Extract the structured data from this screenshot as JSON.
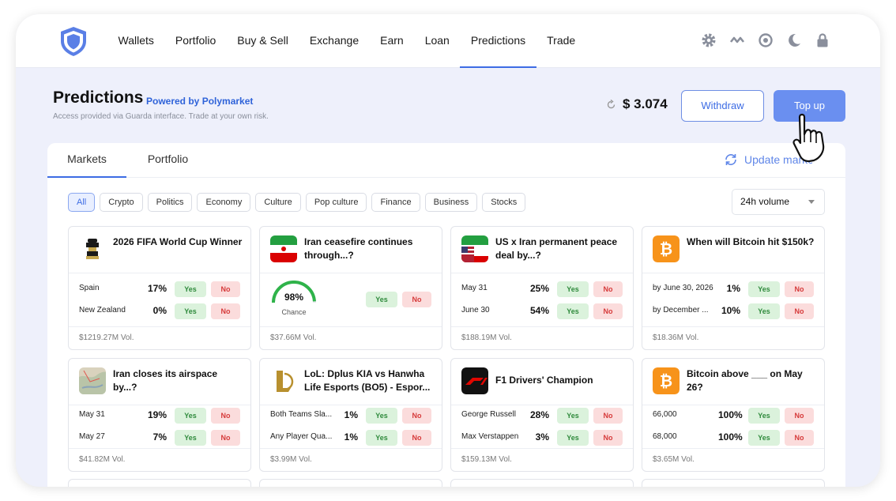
{
  "nav": {
    "items": [
      "Wallets",
      "Portfolio",
      "Buy & Sell",
      "Exchange",
      "Earn",
      "Loan",
      "Predictions",
      "Trade"
    ],
    "active": "Predictions"
  },
  "header": {
    "title": "Predictions",
    "powered_by": "Powered by Polymarket",
    "subtitle": "Access provided via Guarda interface. Trade at your own risk.",
    "balance": "$ 3.074",
    "withdraw_label": "Withdraw",
    "topup_label": "Top up"
  },
  "tabs": {
    "markets": "Markets",
    "portfolio": "Portfolio"
  },
  "update_label": "Update markets",
  "filters": [
    "All",
    "Crypto",
    "Politics",
    "Economy",
    "Culture",
    "Pop culture",
    "Finance",
    "Business",
    "Stocks"
  ],
  "sort_label": "24h volume",
  "yes_label": "Yes",
  "no_label": "No",
  "colors": {
    "accent": "#3d6ce4",
    "yes_bg": "#dbf2dc",
    "no_bg": "#fbdcdc"
  },
  "cards": [
    {
      "title": "2026 FIFA World Cup Winner",
      "icon": "world-cup-trophy-icon",
      "rows": [
        {
          "label": "Spain",
          "pct": "17%"
        },
        {
          "label": "New Zealand",
          "pct": "0%"
        }
      ],
      "volume": "$1219.27M Vol."
    },
    {
      "title": "Iran ceasefire continues through...?",
      "icon": "iran-flag-icon",
      "chance": "98%",
      "chance_value": 0.98,
      "chance_label": "Chance",
      "volume": "$37.66M Vol."
    },
    {
      "title": "US x Iran permanent peace deal by...?",
      "icon": "us-iran-flags-icon",
      "rows": [
        {
          "label": "May 31",
          "pct": "25%"
        },
        {
          "label": "June 30",
          "pct": "54%"
        }
      ],
      "volume": "$188.19M Vol."
    },
    {
      "title": "When will Bitcoin hit $150k?",
      "icon": "bitcoin-icon",
      "rows": [
        {
          "label": "by June 30, 2026",
          "pct": "1%"
        },
        {
          "label": "by December ...",
          "pct": "10%"
        }
      ],
      "volume": "$18.36M Vol."
    },
    {
      "title": "Iran closes its airspace by...?",
      "icon": "map-icon",
      "rows": [
        {
          "label": "May 31",
          "pct": "19%"
        },
        {
          "label": "May 27",
          "pct": "7%"
        }
      ],
      "volume": "$41.82M Vol."
    },
    {
      "title": "LoL: Dplus KIA vs Hanwha Life Esports (BO5) - Espor...",
      "icon": "league-of-legends-icon",
      "rows": [
        {
          "label": "Both Teams Sla...",
          "pct": "1%"
        },
        {
          "label": "Any Player Qua...",
          "pct": "1%"
        }
      ],
      "volume": "$3.99M Vol."
    },
    {
      "title": "F1 Drivers' Champion",
      "icon": "f1-logo-icon",
      "rows": [
        {
          "label": "George Russell",
          "pct": "28%"
        },
        {
          "label": "Max Verstappen",
          "pct": "3%"
        }
      ],
      "volume": "$159.13M Vol."
    },
    {
      "title": "Bitcoin above ___ on May 26?",
      "icon": "bitcoin-icon",
      "rows": [
        {
          "label": "66,000",
          "pct": "100%"
        },
        {
          "label": "68,000",
          "pct": "100%"
        }
      ],
      "volume": "$3.65M Vol."
    }
  ]
}
